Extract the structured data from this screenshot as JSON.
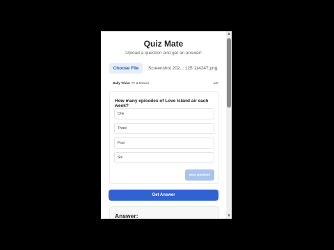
{
  "app": {
    "title": "Quiz Mate",
    "subtitle": "Upload a question and get an answer!"
  },
  "upload": {
    "choose_file_label": "Choose File",
    "file_name": "Screenshot 202... 125 114247.png"
  },
  "quiz": {
    "category_label": "Daily Trivia:",
    "category_value": "TV & Movies",
    "progress": "1/5",
    "question": "How many episodes of Love Island air each week?",
    "options": [
      "One",
      "Three",
      "Four",
      "Six"
    ],
    "next_label": "Next Question"
  },
  "get_answer_label": "Get Answer",
  "answer": {
    "heading": "Answer:"
  },
  "colors": {
    "primary": "#2f63d4",
    "disabled_button": "#a9c3ee",
    "choose_file_bg": "#e8eef9"
  }
}
